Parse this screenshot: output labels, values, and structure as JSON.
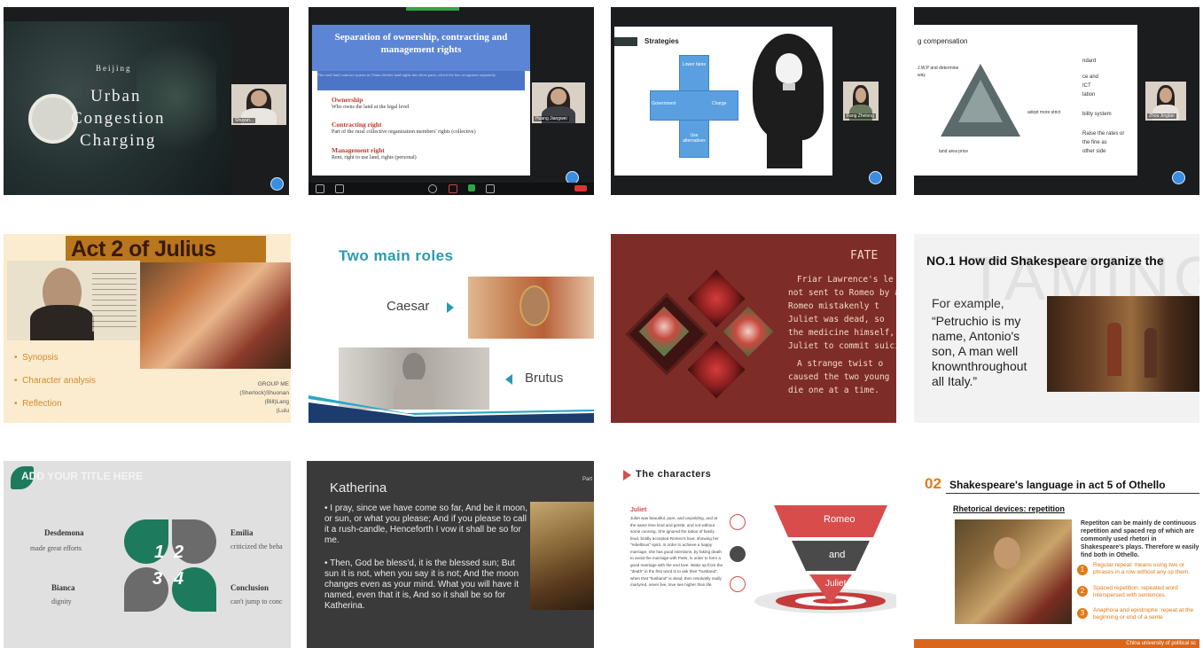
{
  "tiles": {
    "t1": {
      "small": "Beijing",
      "title1": "Urban",
      "title2": "Congestion",
      "title3": "Charging",
      "cam": "Shuyun..."
    },
    "t2": {
      "title": "Separation of ownership, contracting and management rights",
      "intro": "The rural land contract system in China divides land rights into three parts, which the law recognizes separately.",
      "h1": "Ownership",
      "d1": "Who owns the land at the legal level",
      "h2": "Contracting right",
      "d2": "Part of the rural collective organization members' rights (collective)",
      "h3": "Management right",
      "d3": "Rent, right to use land, rights (personal)",
      "cam": "Huang Jiangwei"
    },
    "t3": {
      "heading": "Strategies",
      "c_top": "Lower fares",
      "c_left": "Government",
      "c_right": "Charge",
      "c_bottom": "Use alternatives",
      "cam": "Fang Zhelong"
    },
    "t4": {
      "heading": "g compensation",
      "l1": "ndard",
      "l2": "ce and",
      "l3": "ICT",
      "l4": "lation",
      "l5": "bility system",
      "l6": "Raise the rates or",
      "l7": "the fine as",
      "l8": "other side",
      "left1": "J.W.P and determine",
      "left2": "way",
      "mid": "adopt more strict",
      "low": "land area price",
      "cam": "Zhou Jinglan"
    },
    "t5": {
      "title": "Act 2 of Julius Caesar",
      "b1": "Synopsis",
      "b2": "Character analysis",
      "b3": "Reflection",
      "g1": "GROUP ME",
      "g2": "(Sherlock)Shuonan",
      "g3": "(Bill)Lang",
      "g4": "(Lulu"
    },
    "t6": {
      "title": "Two main roles",
      "caesar": "Caesar",
      "brutus": "Brutus"
    },
    "t7": {
      "title": "FATE",
      "p1": "Friar Lawrence's le",
      "p2": "not sent to Romeo by ac",
      "p3": "Romeo mistakenly t",
      "p4": "Juliet was dead, so",
      "p5": "the medicine himself,",
      "p6": "Juliet to commit suicid",
      "p7": "A strange twist o",
      "p8": "caused the two young",
      "p9": "die one at a time."
    },
    "t8": {
      "title": "NO.1 How did Shakespeare organize the",
      "bg": "TAMING SH",
      "q1": "For example,",
      "q2": "“Petruchio is my",
      "q3": "name, Antonio's",
      "q4": "son, A man well",
      "q5": "knownthroughout",
      "q6": "all Italy.”"
    },
    "t9": {
      "title": "ADD YOUR TITLE HERE",
      "n1": "Desdemona",
      "s1": "made great efforts",
      "n2": "Emilia",
      "s2": "criticized the beha",
      "n3": "Bianca",
      "s3": "dignity",
      "n4": "Conclusion",
      "s4": "can't jump to conc",
      "k1": "1",
      "k2": "2",
      "k3": "3",
      "k4": "4"
    },
    "t10": {
      "title": "Katherina",
      "corner": "Part",
      "b1": "I pray, since we have come so far, And be it moon, or sun, or what you please; And if you please to call it a rush-candle, Henceforth I vow it shall be so for me.",
      "b2": "Then, God be bless'd, it is the blessed sun; But sun it is not, when you say it is not; And the moon changes even as your mind. What you will have it named, even that it is, And so it shall be so for Katherina."
    },
    "t11": {
      "title": "The characters",
      "juliet": "Juliet",
      "body": "Juliet was beautiful, pure, and unyielding, and at the same time kind and gentle, and not without some cunning. She ignored the taboo of family feud, boldly accepted Romeo's love, showing her \"rebellious\" spirit. In order to achieve a happy marriage, she has good intentions, by faking death to avoid the marriage with Paris, in order to form a good marriage with the end love. Wake up from the \"death\" in the first word is to ask their \"husband\", when that \"husband\" is dead, then resolutely really martyred, never live, love see higher than life.",
      "f1": "Romeo",
      "f2": "and",
      "f3": "Juliet"
    },
    "t12": {
      "num": "02",
      "title": "Shakespeare's language in act 5 of Othello",
      "sub": "Rhetorical devices: repetition",
      "intro": "Repetiton can be mainly de continuous repetition and spaced rep of which are commonly used rhetori in Shakespeare's plays. Therefore w easily find both in Othello.",
      "p1": "Regular repeat: means using two or phrases in a row without any sp them.",
      "p2": "Spaced repetition: repeated word interspersed with sentences.",
      "p3": "Anaphora and epistrophe :repeat at the beginning or end of a sente",
      "footer": "China university of political sc"
    }
  },
  "colors": {
    "accent_teal": "#1e7a5c",
    "fate_red": "#8b2f2a",
    "roles_title": "#2a9ab0",
    "triangle_red": "#d94c4c",
    "othello_orange": "#e07a17"
  }
}
